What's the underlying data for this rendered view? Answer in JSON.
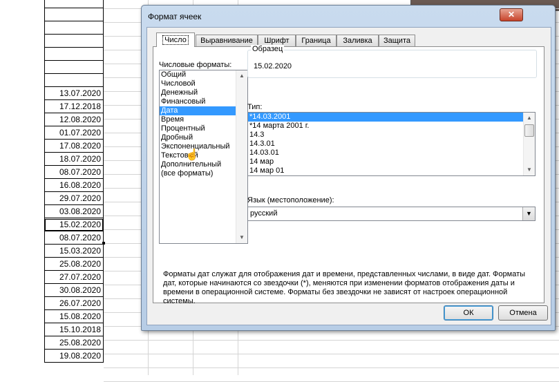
{
  "sheet": {
    "dates": [
      "",
      "",
      "",
      "",
      "",
      "",
      "",
      "13.07.2020",
      "17.12.2018",
      "12.08.2020",
      "01.07.2020",
      "17.08.2020",
      "18.07.2020",
      "08.07.2020",
      "16.08.2020",
      "29.07.2020",
      "03.08.2020",
      "15.02.2020",
      "08.07.2020",
      "15.03.2020",
      "25.08.2020",
      "27.07.2020",
      "30.08.2020",
      "26.07.2020",
      "15.08.2020",
      "15.10.2018",
      "25.08.2020",
      "19.08.2020"
    ],
    "active_row": 17
  },
  "dialog": {
    "title": "Формат ячеек",
    "close_label": "✕",
    "tabs": [
      "Число",
      "Выравнивание",
      "Шрифт",
      "Граница",
      "Заливка",
      "Защита"
    ],
    "selected_tab": 0,
    "formats_label": "Числовые форматы:",
    "formats": [
      "Общий",
      "Числовой",
      "Денежный",
      "Финансовый",
      "Дата",
      "Время",
      "Процентный",
      "Дробный",
      "Экспоненциальный",
      "Текстовый",
      "Дополнительный",
      "(все форматы)"
    ],
    "selected_format": 4,
    "sample_label": "Образец",
    "sample_value": "15.02.2020",
    "type_label": "Тип:",
    "types": [
      "*14.03.2001",
      "*14 марта 2001 г.",
      "14.3",
      "14.3.01",
      "14.03.01",
      "14 мар",
      "14 мар 01"
    ],
    "selected_type": 0,
    "lang_label": "Язык (местоположение):",
    "lang_value": "русский",
    "description": "Форматы дат служат для отображения дат и времени, представленных числами, в виде дат. Форматы дат, которые начинаются со звездочки (*), меняются при изменении форматов отображения даты и времени в операционной системе. Форматы без звездочки не зависят от настроек операционной системы.",
    "ok_label": "ОК",
    "cancel_label": "Отмена"
  },
  "colors": {
    "selection": "#3399ff",
    "dialog_frame": "#c9dbee"
  }
}
